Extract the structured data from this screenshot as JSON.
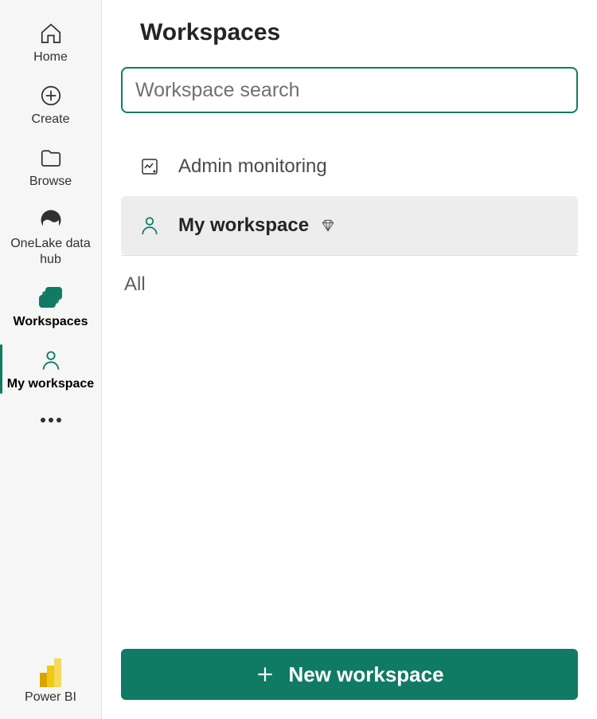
{
  "sidebar": {
    "items": [
      {
        "label": "Home"
      },
      {
        "label": "Create"
      },
      {
        "label": "Browse"
      },
      {
        "label": "OneLake data hub"
      },
      {
        "label": "Workspaces"
      },
      {
        "label": "My workspace"
      }
    ],
    "brand_label": "Power BI"
  },
  "panel": {
    "title": "Workspaces",
    "search_placeholder": "Workspace search",
    "items": [
      {
        "label": "Admin monitoring",
        "selected": false
      },
      {
        "label": "My workspace",
        "selected": true
      }
    ],
    "section_label": "All",
    "new_button_label": "New workspace"
  },
  "colors": {
    "accent": "#0f7b64"
  }
}
